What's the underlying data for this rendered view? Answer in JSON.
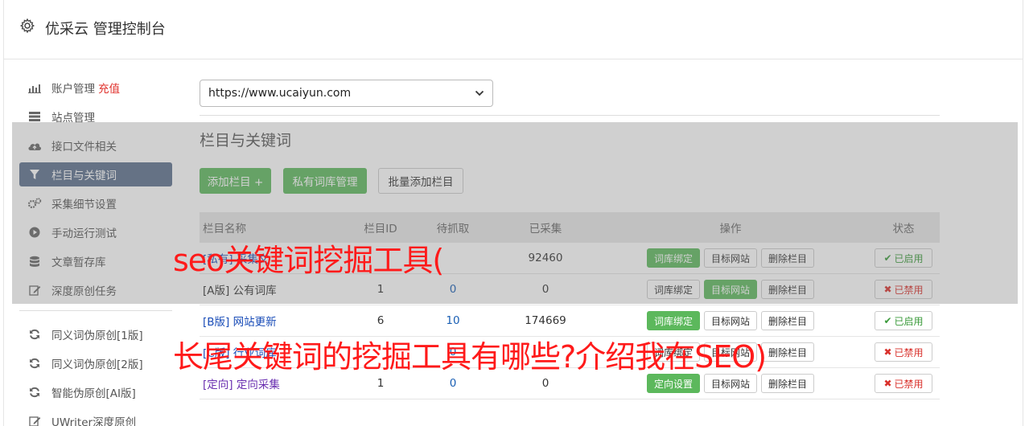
{
  "header": {
    "title": "优采云 管理控制台",
    "icon": "gear-icon"
  },
  "sidebar": {
    "group1": [
      {
        "label": "账户管理",
        "extra": "充值",
        "icon": "bar-chart-icon"
      },
      {
        "label": "站点管理",
        "extra": "",
        "icon": "server-icon"
      },
      {
        "label": "接口文件相关",
        "extra": "",
        "icon": "cloud-upload-icon"
      },
      {
        "label": "栏目与关键词",
        "extra": "",
        "icon": "filter-icon",
        "active": true
      },
      {
        "label": "采集细节设置",
        "extra": "",
        "icon": "cogs-icon"
      },
      {
        "label": "手动运行测试",
        "extra": "",
        "icon": "play-circle-icon"
      },
      {
        "label": "文章暂存库",
        "extra": "",
        "icon": "database-icon"
      },
      {
        "label": "深度原创任务",
        "extra": "",
        "icon": "edit-icon"
      }
    ],
    "group2": [
      {
        "label": "同义词伪原创[1版]",
        "icon": "refresh-icon"
      },
      {
        "label": "同义词伪原创[2版]",
        "icon": "refresh-icon"
      },
      {
        "label": "智能伪原创[AI版]",
        "icon": "refresh-icon"
      },
      {
        "label": "UWriter深度原创",
        "icon": "edit-icon"
      }
    ]
  },
  "site_select": {
    "value": "https://www.ucaiyun.com"
  },
  "section": {
    "title": "栏目与关键词"
  },
  "toolbar": {
    "add_column": "添加栏目 +",
    "private_lib": "私有词库管理",
    "batch_add": "批量添加栏目"
  },
  "table": {
    "headers": {
      "name": "栏目名称",
      "id": "栏目ID",
      "grab": "待抓取",
      "got": "已采集",
      "ops": "操作",
      "status": "状态"
    },
    "rows": [
      {
        "prefix": "[私有]",
        "name": "采集文",
        "id": "",
        "grab": "",
        "got": "92460",
        "op1": "词库绑定",
        "op1_green": true,
        "op2": "目标网站",
        "op2_green": false,
        "op3": "删除栏目",
        "status": "已启用",
        "status_on": true
      },
      {
        "prefix": "[A版]",
        "name": "公有词库",
        "id": "1",
        "grab": "0",
        "got": "0",
        "op1": "词库绑定",
        "op1_green": false,
        "op2": "目标网站",
        "op2_green": true,
        "op3": "删除栏目",
        "status": "已禁用",
        "status_on": false
      },
      {
        "prefix": "[B版]",
        "name": "网站更新",
        "id": "6",
        "grab": "10",
        "got": "174669",
        "op1": "词库绑定",
        "op1_green": true,
        "op2": "目标网站",
        "op2_green": false,
        "op3": "删除栏目",
        "status": "已启用",
        "status_on": true
      },
      {
        "prefix": "[C版]",
        "name": "行业词库",
        "id": "",
        "grab": "0",
        "got": "",
        "op1": "词库绑定",
        "op1_green": false,
        "op2": "目标网站",
        "op2_green": false,
        "op3": "删除栏目",
        "status": "已禁用",
        "status_on": false
      },
      {
        "prefix": "[定向]",
        "name": "定向采集",
        "id": "1",
        "grab": "0",
        "got": "0",
        "op1": "定向设置",
        "op1_green": true,
        "op2": "目标网站",
        "op2_green": false,
        "op3": "删除栏目",
        "status": "已禁用",
        "status_on": false
      }
    ]
  },
  "watermark": {
    "line1": "seo关键词挖掘工具(",
    "line2": "长尾关键词的挖掘工具有哪些?介绍我在SEO)"
  },
  "colors": {
    "green": "#5cb85c",
    "active_bg": "#5b6f8d",
    "red": "#ff1a1a"
  }
}
